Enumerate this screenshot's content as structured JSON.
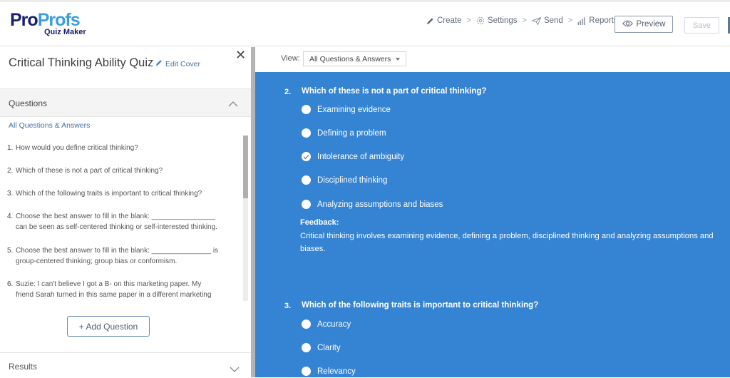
{
  "brand": {
    "logo_pro": "Pro",
    "logo_profs": "Profs",
    "logo_sub": "Quiz Maker"
  },
  "nav": {
    "items": [
      {
        "label": "Create",
        "icon": "pencil-icon"
      },
      {
        "label": "Settings",
        "icon": "gear-icon"
      },
      {
        "label": "Send",
        "icon": "paper-plane-icon"
      },
      {
        "label": "Reports",
        "icon": "bar-chart-icon"
      }
    ],
    "separator": ">",
    "preview_label": "Preview",
    "save_label": "Save"
  },
  "sidebar": {
    "quiz_title": "Critical Thinking Ability Quiz",
    "edit_cover_label": "Edit Cover",
    "close_label": "✕",
    "questions_section_title": "Questions",
    "all_qa_link": "All Questions & Answers",
    "questions": [
      {
        "num": "1.",
        "text": "How would you define critical thinking?"
      },
      {
        "num": "2.",
        "text": "Which of these is not a part of critical thinking?"
      },
      {
        "num": "3.",
        "text": "Which of the following traits is important to critical thinking?"
      },
      {
        "num": "4.",
        "text": "Choose the best answer to fill in the blank: ________________ can be seen as self-centered thinking or self-interested thinking."
      },
      {
        "num": "5.",
        "text": "Choose the best answer to fill in the blank: _______________  is group-centered thinking; group bias or conformism."
      },
      {
        "num": "6.",
        "text": "Suzie: I can't believe I got a B- on this marketing paper. My friend Sarah turned in this same paper in a different marketing class"
      }
    ],
    "add_question_label": "+ Add Question",
    "results_section_title": "Results"
  },
  "main": {
    "view_label": "View:",
    "view_selected": "All Questions & Answers",
    "questions": [
      {
        "num": "2.",
        "title": "Which of these is not a part of critical thinking?",
        "options": [
          {
            "label": "Examining evidence",
            "correct": false
          },
          {
            "label": "Defining a problem",
            "correct": false
          },
          {
            "label": "Intolerance of ambiguity",
            "correct": true
          },
          {
            "label": "Disciplined thinking",
            "correct": false
          },
          {
            "label": "Analyzing assumptions and biases",
            "correct": false
          }
        ],
        "feedback_label": "Feedback:",
        "feedback_text": "Critical thinking involves examining evidence, defining a problem, disciplined thinking and analyzing assumptions and biases."
      },
      {
        "num": "3.",
        "title": "Which of the following traits is important to critical thinking?",
        "options": [
          {
            "label": "Accuracy",
            "correct": false
          },
          {
            "label": "Clarity",
            "correct": false
          },
          {
            "label": "Relevancy",
            "correct": false
          }
        ]
      }
    ]
  },
  "colors": {
    "brand_dark": "#1b1f6b",
    "brand_light": "#3b9ee0",
    "accent_blue": "#3583d3",
    "link": "#4a6fa5"
  }
}
